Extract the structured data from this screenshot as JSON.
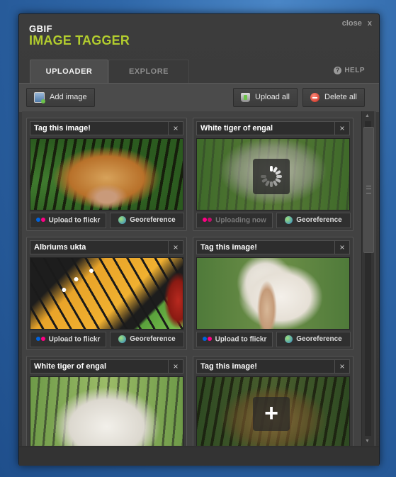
{
  "app": {
    "brand_small": "GBIF",
    "brand_big": "IMAGE TAGGER",
    "close_label": "close",
    "close_x": "x",
    "help_label": "HELP"
  },
  "tabs": [
    {
      "label": "UPLOADER",
      "active": true
    },
    {
      "label": "EXPLORE",
      "active": false
    }
  ],
  "toolbar": {
    "add_image": "Add image",
    "upload_all": "Upload all",
    "delete_all": "Delete all"
  },
  "cards": [
    {
      "title": "Tag this image!",
      "upload_label": "Upload to flickr",
      "geo_label": "Georeference",
      "image": "tiger",
      "state": "idle"
    },
    {
      "title": "White tiger of engal",
      "upload_label": "Uploading now",
      "geo_label": "Georeference",
      "image": "white-tiger",
      "state": "uploading"
    },
    {
      "title": "Albriums ukta",
      "upload_label": "Upload to flickr",
      "geo_label": "Georeference",
      "image": "butterfly",
      "state": "idle"
    },
    {
      "title": "Tag this image!",
      "upload_label": "Upload to flickr",
      "geo_label": "Georeference",
      "image": "pelican",
      "state": "idle"
    },
    {
      "title": "White tiger of engal",
      "image": "white-tiger",
      "state": "idle"
    },
    {
      "title": "Tag this image!",
      "image": "tiger",
      "state": "add"
    }
  ],
  "colors": {
    "accent_green": "#b2cc2e",
    "flickr_blue": "#0063dc",
    "flickr_pink": "#ff0084",
    "delete_red": "#d23a2b"
  }
}
